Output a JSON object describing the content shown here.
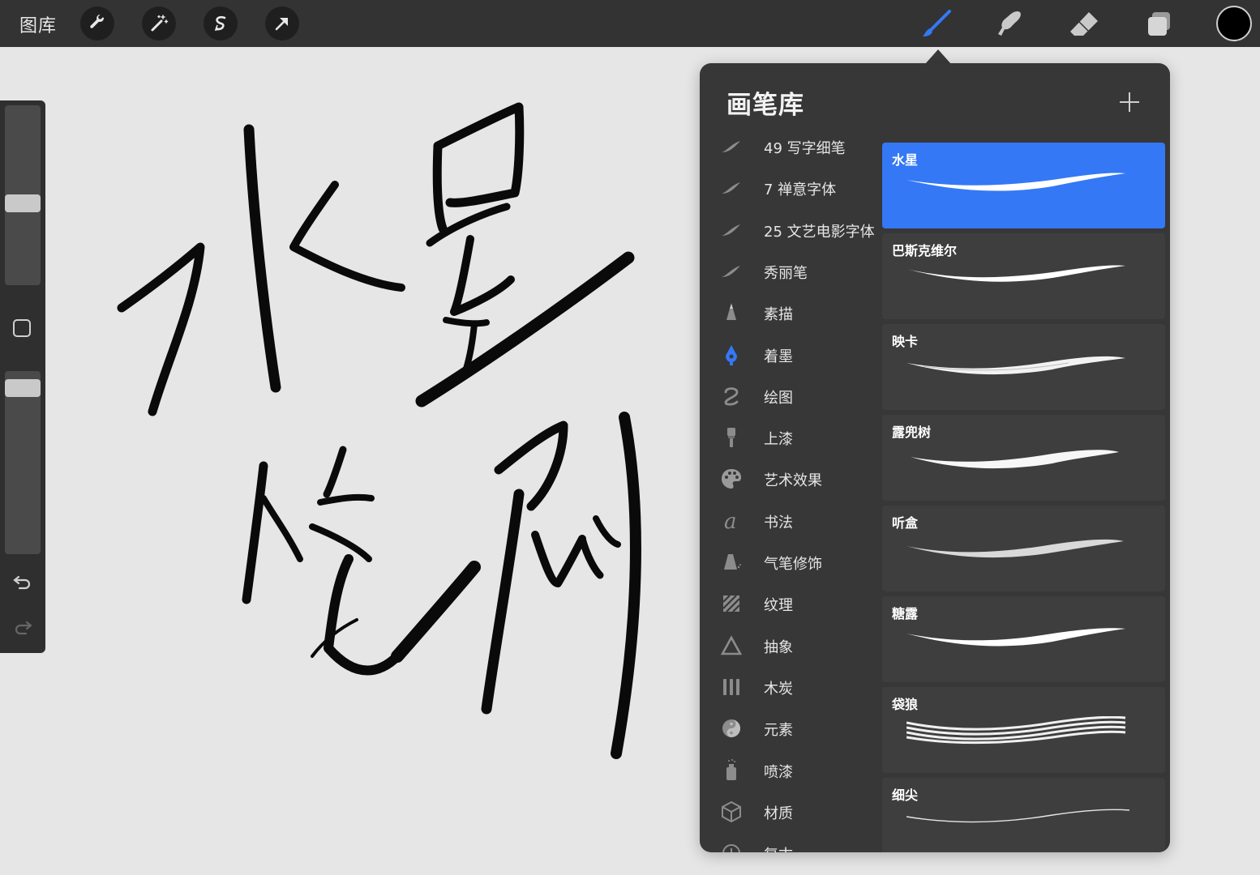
{
  "topbar": {
    "gallery_label": "图库",
    "left_tools": [
      "wrench-icon",
      "magic-wand-icon",
      "selection-icon",
      "transform-arrow-icon"
    ],
    "right_tools": [
      "brush-icon",
      "smudge-icon",
      "eraser-icon",
      "layers-icon"
    ],
    "active_tool": "brush-icon",
    "current_color": "#000000",
    "accent_color": "#3478f6"
  },
  "sidebar": {
    "size_slider": 0.45,
    "opacity_slider": 0.95,
    "icons": [
      "modify-square-icon",
      "undo-icon",
      "redo-icon"
    ]
  },
  "brush_library": {
    "title": "画笔库",
    "add_icon": "plus-icon",
    "categories": [
      {
        "label": "49 写字细笔",
        "icon": "brush-stroke-icon"
      },
      {
        "label": "7 禅意字体",
        "icon": "brush-stroke-icon"
      },
      {
        "label": "25 文艺电影字体",
        "icon": "brush-stroke-icon"
      },
      {
        "label": "秀丽笔",
        "icon": "brush-stroke-icon"
      },
      {
        "label": "素描",
        "icon": "pencil-tip-icon"
      },
      {
        "label": "着墨",
        "icon": "ink-drop-icon",
        "selected": true
      },
      {
        "label": "绘图",
        "icon": "squiggle-icon"
      },
      {
        "label": "上漆",
        "icon": "paint-brush-icon"
      },
      {
        "label": "艺术效果",
        "icon": "palette-icon"
      },
      {
        "label": "书法",
        "icon": "calligraphy-a-icon"
      },
      {
        "label": "气笔修饰",
        "icon": "airbrush-icon"
      },
      {
        "label": "纹理",
        "icon": "texture-icon"
      },
      {
        "label": "抽象",
        "icon": "triangle-icon"
      },
      {
        "label": "木炭",
        "icon": "charcoal-icon"
      },
      {
        "label": "元素",
        "icon": "yin-yang-icon"
      },
      {
        "label": "喷漆",
        "icon": "spray-can-icon"
      },
      {
        "label": "材质",
        "icon": "cube-icon"
      },
      {
        "label": "复古",
        "icon": "retro-icon"
      }
    ],
    "brushes": [
      {
        "name": "水星",
        "selected": true
      },
      {
        "name": "巴斯克维尔"
      },
      {
        "name": "映卡"
      },
      {
        "name": "露兜树"
      },
      {
        "name": "听盒"
      },
      {
        "name": "糖露"
      },
      {
        "name": "袋狼"
      },
      {
        "name": "细尖"
      }
    ]
  },
  "canvas": {
    "content": "handwritten-calligraphy"
  }
}
